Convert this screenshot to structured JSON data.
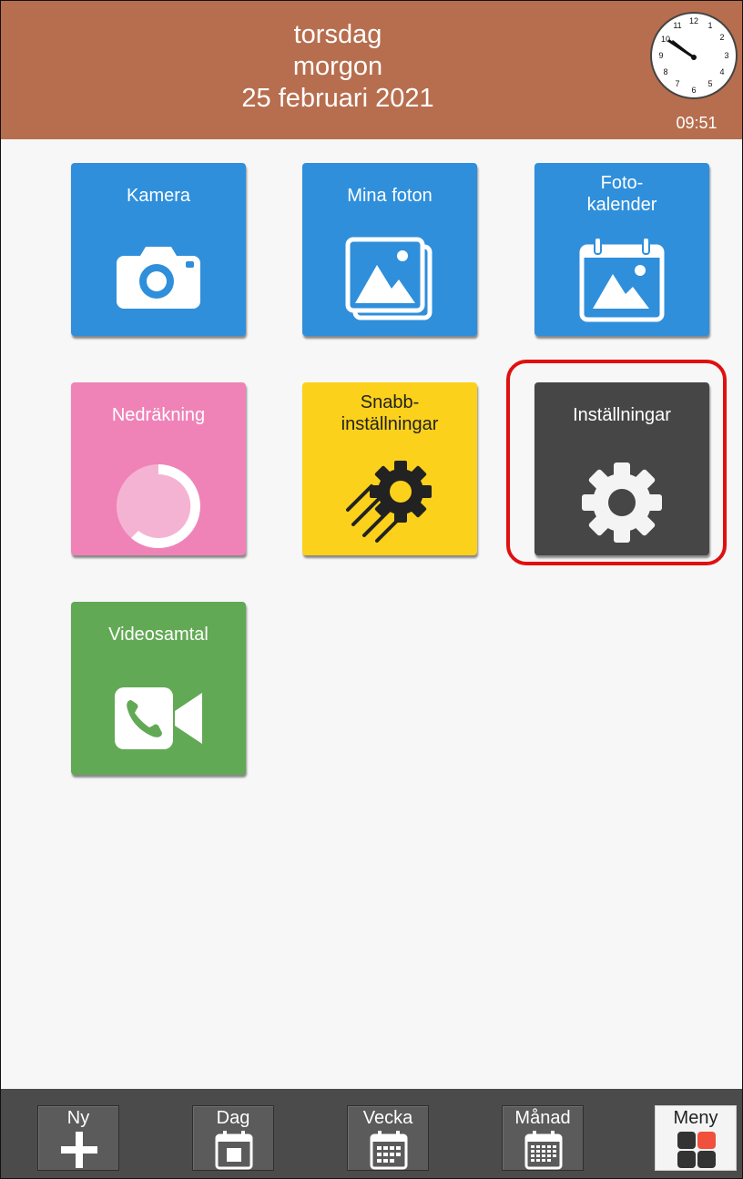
{
  "header": {
    "day": "torsdag",
    "part_of_day": "morgon",
    "date": "25 februari 2021",
    "time": "09:51",
    "clock_numbers": [
      "12",
      "1",
      "2",
      "3",
      "4",
      "5",
      "6",
      "7",
      "8",
      "9",
      "10",
      "11"
    ],
    "color": "#b76e4e"
  },
  "tiles": [
    {
      "label": "Kamera",
      "icon": "camera-icon",
      "color": "#2f8fdb"
    },
    {
      "label": "Mina foton",
      "icon": "photos-icon",
      "color": "#2f8fdb"
    },
    {
      "label": "Foto-\nkalender",
      "icon": "photo-calendar-icon",
      "color": "#2f8fdb"
    },
    {
      "label": "Nedräkning",
      "icon": "countdown-icon",
      "color": "#ef83b8"
    },
    {
      "label": "Snabb-\ninställningar",
      "icon": "quick-settings-icon",
      "color": "#fbd11b"
    },
    {
      "label": "Inställningar",
      "icon": "gear-icon",
      "color": "#464646"
    },
    {
      "label": "Videosamtal",
      "icon": "video-call-icon",
      "color": "#62a955"
    }
  ],
  "highlight_color": "#e01010",
  "nav": [
    {
      "label": "Ny",
      "icon": "plus-icon"
    },
    {
      "label": "Dag",
      "icon": "day-calendar-icon"
    },
    {
      "label": "Vecka",
      "icon": "week-calendar-icon"
    },
    {
      "label": "Månad",
      "icon": "month-calendar-icon"
    },
    {
      "label": "Meny",
      "icon": "menu-grid-icon",
      "active": true
    }
  ]
}
